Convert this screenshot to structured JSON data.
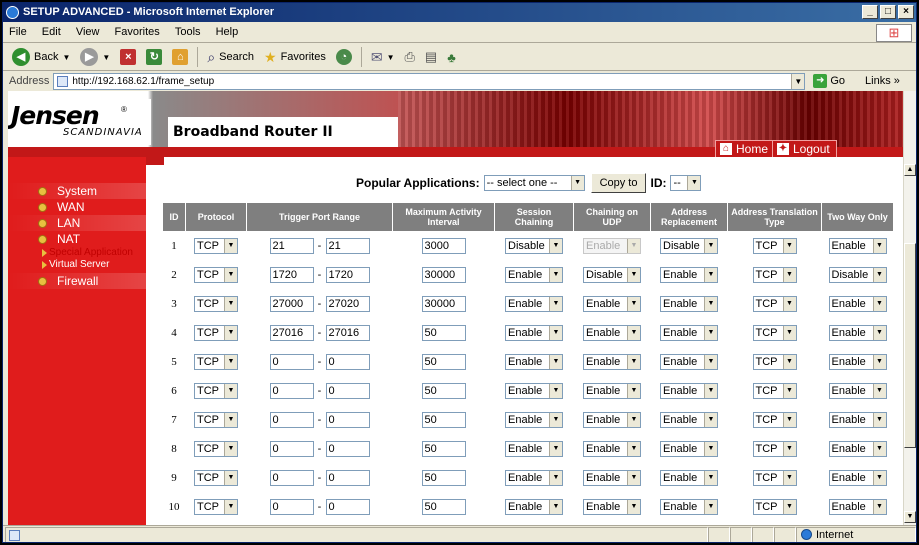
{
  "window": {
    "title": "SETUP ADVANCED - Microsoft Internet Explorer"
  },
  "menu": [
    "File",
    "Edit",
    "View",
    "Favorites",
    "Tools",
    "Help"
  ],
  "toolbar": {
    "back": "Back",
    "search": "Search",
    "favorites": "Favorites"
  },
  "address": {
    "label": "Address",
    "url": "http://192.168.62.1/frame_setup",
    "go": "Go",
    "links": "Links"
  },
  "header": {
    "brand": "Jensen",
    "brand_sub": "SCANDINAVIA",
    "product": "Broadband Router II",
    "home": "Home",
    "logout": "Logout"
  },
  "nav": {
    "items": [
      {
        "label": "System"
      },
      {
        "label": "WAN"
      },
      {
        "label": "LAN"
      },
      {
        "label": "NAT"
      },
      {
        "label": "Firewall"
      }
    ],
    "sub": [
      {
        "label": "Special Application",
        "color": "#c00000"
      },
      {
        "label": "Virtual Server",
        "color": "#ffffff"
      }
    ]
  },
  "popular": {
    "label": "Popular Applications:",
    "selected": "-- select one --",
    "copy": "Copy to",
    "id_label": "ID:",
    "id_value": "--"
  },
  "table": {
    "headers": [
      "ID",
      "Protocol",
      "Trigger Port Range",
      "Maximum Activity Interval",
      "Session Chaining",
      "Chaining on UDP",
      "Address Replacement",
      "Address Translation Type",
      "Two Way Only"
    ],
    "rows": [
      {
        "id": "1",
        "protocol": "TCP",
        "port_from": "21",
        "port_to": "21",
        "interval": "3000",
        "session": "Disable",
        "udp": "Enable",
        "udp_disabled": true,
        "replace": "Disable",
        "trans": "TCP",
        "twoway": "Enable"
      },
      {
        "id": "2",
        "protocol": "TCP",
        "port_from": "1720",
        "port_to": "1720",
        "interval": "30000",
        "session": "Enable",
        "udp": "Disable",
        "udp_disabled": false,
        "replace": "Enable",
        "trans": "TCP",
        "twoway": "Disable"
      },
      {
        "id": "3",
        "protocol": "TCP",
        "port_from": "27000",
        "port_to": "27020",
        "interval": "30000",
        "session": "Enable",
        "udp": "Enable",
        "udp_disabled": false,
        "replace": "Enable",
        "trans": "TCP",
        "twoway": "Enable"
      },
      {
        "id": "4",
        "protocol": "TCP",
        "port_from": "27016",
        "port_to": "27016",
        "interval": "50",
        "session": "Enable",
        "udp": "Enable",
        "udp_disabled": false,
        "replace": "Enable",
        "trans": "TCP",
        "twoway": "Enable"
      },
      {
        "id": "5",
        "protocol": "TCP",
        "port_from": "0",
        "port_to": "0",
        "interval": "50",
        "session": "Enable",
        "udp": "Enable",
        "udp_disabled": false,
        "replace": "Enable",
        "trans": "TCP",
        "twoway": "Enable"
      },
      {
        "id": "6",
        "protocol": "TCP",
        "port_from": "0",
        "port_to": "0",
        "interval": "50",
        "session": "Enable",
        "udp": "Enable",
        "udp_disabled": false,
        "replace": "Enable",
        "trans": "TCP",
        "twoway": "Enable"
      },
      {
        "id": "7",
        "protocol": "TCP",
        "port_from": "0",
        "port_to": "0",
        "interval": "50",
        "session": "Enable",
        "udp": "Enable",
        "udp_disabled": false,
        "replace": "Enable",
        "trans": "TCP",
        "twoway": "Enable"
      },
      {
        "id": "8",
        "protocol": "TCP",
        "port_from": "0",
        "port_to": "0",
        "interval": "50",
        "session": "Enable",
        "udp": "Enable",
        "udp_disabled": false,
        "replace": "Enable",
        "trans": "TCP",
        "twoway": "Enable"
      },
      {
        "id": "9",
        "protocol": "TCP",
        "port_from": "0",
        "port_to": "0",
        "interval": "50",
        "session": "Enable",
        "udp": "Enable",
        "udp_disabled": false,
        "replace": "Enable",
        "trans": "TCP",
        "twoway": "Enable"
      },
      {
        "id": "10",
        "protocol": "TCP",
        "port_from": "0",
        "port_to": "0",
        "interval": "50",
        "session": "Enable",
        "udp": "Enable",
        "udp_disabled": false,
        "replace": "Enable",
        "trans": "TCP",
        "twoway": "Enable"
      }
    ]
  },
  "status": {
    "zone": "Internet"
  },
  "colors": {
    "brand_red": "#e01c1c",
    "header_gray": "#7f7f7f",
    "nav_dot": "#e8c040"
  }
}
